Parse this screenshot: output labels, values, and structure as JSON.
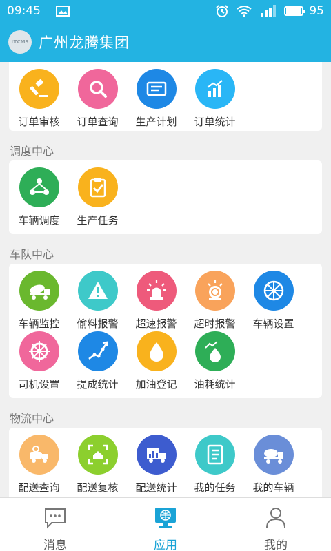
{
  "status_bar": {
    "time": "09:45",
    "battery": "95",
    "battery_level": 0.95
  },
  "header": {
    "title": "广州龙腾集团",
    "logo_text": "LTCMS"
  },
  "sections": [
    {
      "title": "",
      "items": [
        {
          "label": "订单审核",
          "color": "#f9b21d",
          "icon": "gavel-icon"
        },
        {
          "label": "订单查询",
          "color": "#f0679b",
          "icon": "search-icon"
        },
        {
          "label": "生产计划",
          "color": "#1e88e5",
          "icon": "plan-card-icon"
        },
        {
          "label": "订单统计",
          "color": "#29b6f6",
          "icon": "bar-chart-icon"
        }
      ]
    },
    {
      "title": "调度中心",
      "items": [
        {
          "label": "车辆调度",
          "color": "#2eae57",
          "icon": "network-icon"
        },
        {
          "label": "生产任务",
          "color": "#f9b21d",
          "icon": "clipboard-check-icon"
        }
      ]
    },
    {
      "title": "车队中心",
      "items": [
        {
          "label": "车辆监控",
          "color": "#6ab82e",
          "icon": "mixer-truck-icon"
        },
        {
          "label": "偷料报警",
          "color": "#3ec9c9",
          "icon": "warning-icon"
        },
        {
          "label": "超速报警",
          "color": "#ee5a7b",
          "icon": "siren-icon"
        },
        {
          "label": "超时报警",
          "color": "#f9a35b",
          "icon": "siren-timer-icon"
        },
        {
          "label": "车辆设置",
          "color": "#1e88e5",
          "icon": "wheel-icon"
        },
        {
          "label": "司机设置",
          "color": "#f0679b",
          "icon": "steering-wheel-icon"
        },
        {
          "label": "提成统计",
          "color": "#1e88e5",
          "icon": "trend-line-icon"
        },
        {
          "label": "加油登记",
          "color": "#f9b21d",
          "icon": "drop-icon"
        },
        {
          "label": "油耗统计",
          "color": "#2eae57",
          "icon": "drop-trend-icon"
        }
      ]
    },
    {
      "title": "物流中心",
      "items": [
        {
          "label": "配送查询",
          "color": "#f9b86a",
          "icon": "truck-search-icon"
        },
        {
          "label": "配送复核",
          "color": "#8ccf2e",
          "icon": "frame-check-icon"
        },
        {
          "label": "配送统计",
          "color": "#3d5ccf",
          "icon": "truck-chart-icon"
        },
        {
          "label": "我的任务",
          "color": "#3ec9c9",
          "icon": "task-list-icon"
        },
        {
          "label": "我的车辆",
          "color": "#6a8ed8",
          "icon": "my-truck-icon"
        }
      ]
    }
  ],
  "tabs": [
    {
      "label": "消息",
      "icon": "message-icon",
      "active": false
    },
    {
      "label": "应用",
      "icon": "app-monitor-icon",
      "active": true
    },
    {
      "label": "我的",
      "icon": "person-icon",
      "active": false
    }
  ],
  "colors": {
    "primary": "#23b3e2",
    "tab_active": "#1aa3d6"
  }
}
